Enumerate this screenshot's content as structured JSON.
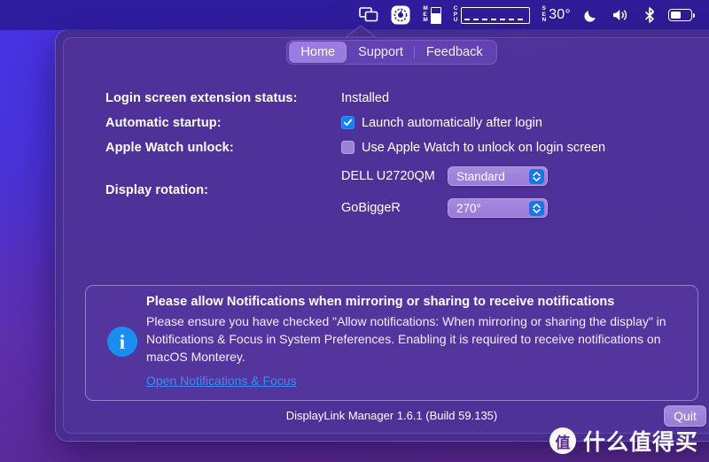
{
  "menubar": {
    "items": [
      {
        "name": "displaylink-icon",
        "label": "",
        "kind": "displaylink"
      },
      {
        "name": "stats-app-icon",
        "label": "",
        "kind": "stats"
      },
      {
        "name": "memory-indicator",
        "label": "MEM",
        "kind": "mem"
      },
      {
        "name": "cpu-indicator",
        "label": "CPU",
        "kind": "cpu"
      },
      {
        "name": "sensor-temperature",
        "label": "SEN",
        "value": "30°",
        "kind": "sensor"
      },
      {
        "name": "do-not-disturb-icon",
        "label": "",
        "kind": "moon"
      },
      {
        "name": "volume-icon",
        "label": "",
        "kind": "volume"
      },
      {
        "name": "bluetooth-icon",
        "label": "",
        "kind": "bluetooth"
      },
      {
        "name": "battery-icon",
        "label": "",
        "kind": "battery"
      }
    ]
  },
  "tabs": [
    {
      "label": "Home",
      "active": true
    },
    {
      "label": "Support",
      "active": false
    },
    {
      "label": "Feedback",
      "active": false
    }
  ],
  "settings": {
    "rows": [
      {
        "label": "Login screen extension status:",
        "value": "Installed"
      },
      {
        "label": "Automatic startup:",
        "checkbox_label": "Launch automatically after login",
        "checked": true
      },
      {
        "label": "Apple Watch unlock:",
        "checkbox_label": "Use Apple Watch to unlock on login screen",
        "checked": false
      },
      {
        "label": "Display rotation:"
      }
    ],
    "displays": [
      {
        "name": "DELL U2720QM",
        "rotation": "Standard"
      },
      {
        "name": "GoBiggeR",
        "rotation": "270°"
      }
    ]
  },
  "notice": {
    "icon": "info-icon",
    "title": "Please allow Notifications when mirroring or sharing to receive notifications",
    "body": "Please ensure you have checked \"Allow notifications: When mirroring or sharing the display\" in Notifications & Focus in System Preferences. Enabling it is required to receive notifications on macOS Monterey.",
    "link": "Open Notifications & Focus"
  },
  "footer": {
    "version": "DisplayLink Manager 1.6.1 (Build 59.135)",
    "quit_label": "Quit"
  },
  "watermark": {
    "badge": "值",
    "text": "什么值得买"
  },
  "colors": {
    "accent_blue": "#0a84ff",
    "link_blue": "#3a8cf5",
    "tab_active": "#9a7ce0",
    "window_bg": "#462d8c",
    "info_icon": "#1b8df0"
  }
}
